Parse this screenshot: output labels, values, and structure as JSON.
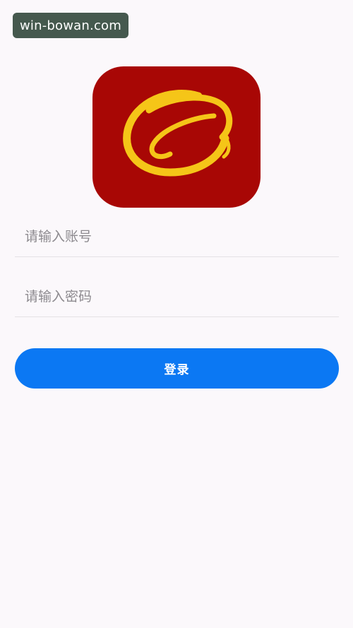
{
  "watermark": {
    "text": "win-bowan.com"
  },
  "logo": {
    "icon": "app-logo-icon",
    "background_color": "#a80705",
    "ring_color": "#f5c518"
  },
  "login_form": {
    "account_placeholder": "请输入账号",
    "password_placeholder": "请输入密码",
    "login_label": "登录",
    "button_color": "#0b78f3"
  }
}
